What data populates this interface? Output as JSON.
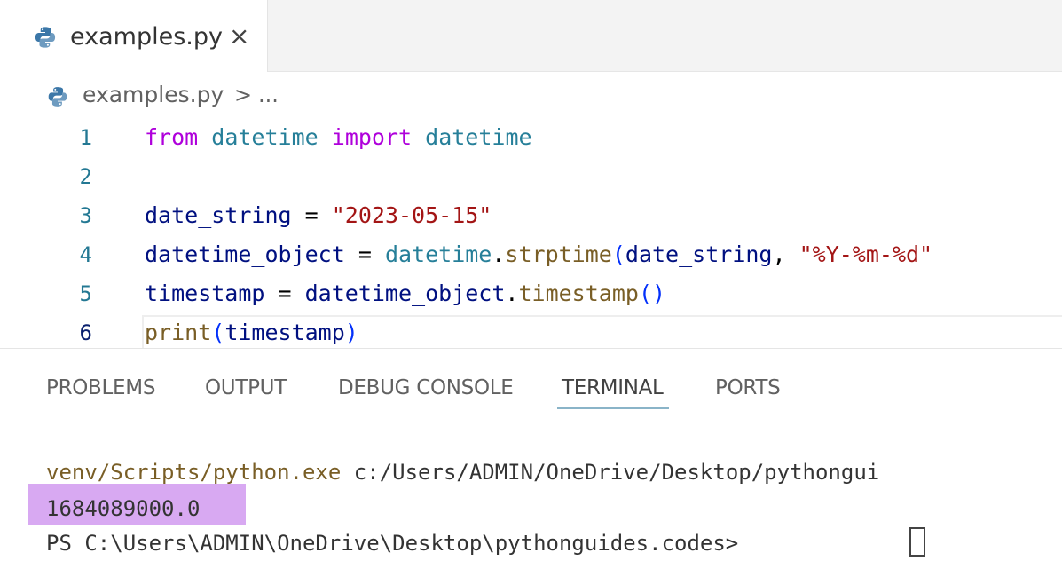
{
  "tab": {
    "filename": "examples.py",
    "close_icon": "×",
    "file_icon": "python-icon"
  },
  "breadcrumb": {
    "file": "examples.py",
    "separator": ">",
    "ellipsis": "..."
  },
  "code_lines": [
    {
      "number": "1",
      "tokens": [
        [
          "kw",
          "from"
        ],
        [
          "sp",
          " "
        ],
        [
          "cls",
          "datetime"
        ],
        [
          "sp",
          " "
        ],
        [
          "kw",
          "import"
        ],
        [
          "sp",
          " "
        ],
        [
          "cls",
          "datetime"
        ]
      ]
    },
    {
      "number": "2",
      "tokens": []
    },
    {
      "number": "3",
      "tokens": [
        [
          "var",
          "date_string"
        ],
        [
          "op",
          " = "
        ],
        [
          "str",
          "\"2023-05-15\""
        ]
      ]
    },
    {
      "number": "4",
      "tokens": [
        [
          "var",
          "datetime_object"
        ],
        [
          "op",
          " = "
        ],
        [
          "cls",
          "datetime"
        ],
        [
          "op",
          "."
        ],
        [
          "fn",
          "strptime"
        ],
        [
          "paren",
          "("
        ],
        [
          "var",
          "date_string"
        ],
        [
          "op",
          ", "
        ],
        [
          "str",
          "\"%Y-%m-%d\""
        ]
      ]
    },
    {
      "number": "5",
      "tokens": [
        [
          "var",
          "timestamp"
        ],
        [
          "op",
          " = "
        ],
        [
          "var",
          "datetime_object"
        ],
        [
          "op",
          "."
        ],
        [
          "fn",
          "timestamp"
        ],
        [
          "paren",
          "()"
        ]
      ]
    },
    {
      "number": "6",
      "tokens": [
        [
          "fn",
          "print"
        ],
        [
          "paren",
          "("
        ],
        [
          "var",
          "timestamp"
        ],
        [
          "paren",
          ")"
        ]
      ]
    }
  ],
  "panel_tabs": [
    "PROBLEMS",
    "OUTPUT",
    "DEBUG CONSOLE",
    "TERMINAL",
    "PORTS"
  ],
  "active_panel_tab": "TERMINAL",
  "terminal": {
    "command_exe": "venv/Scripts/python.exe",
    "command_path": " c:/Users/ADMIN/OneDrive/Desktop/pythongui",
    "output": "1684089000.0",
    "prompt": "PS C:\\Users\\ADMIN\\OneDrive\\Desktop\\pythonguides.codes> "
  },
  "colors": {
    "highlight": "#d8a9f2",
    "keyword": "#af00db",
    "class": "#267f99",
    "string": "#a31515",
    "function": "#795e26",
    "variable": "#001080"
  }
}
